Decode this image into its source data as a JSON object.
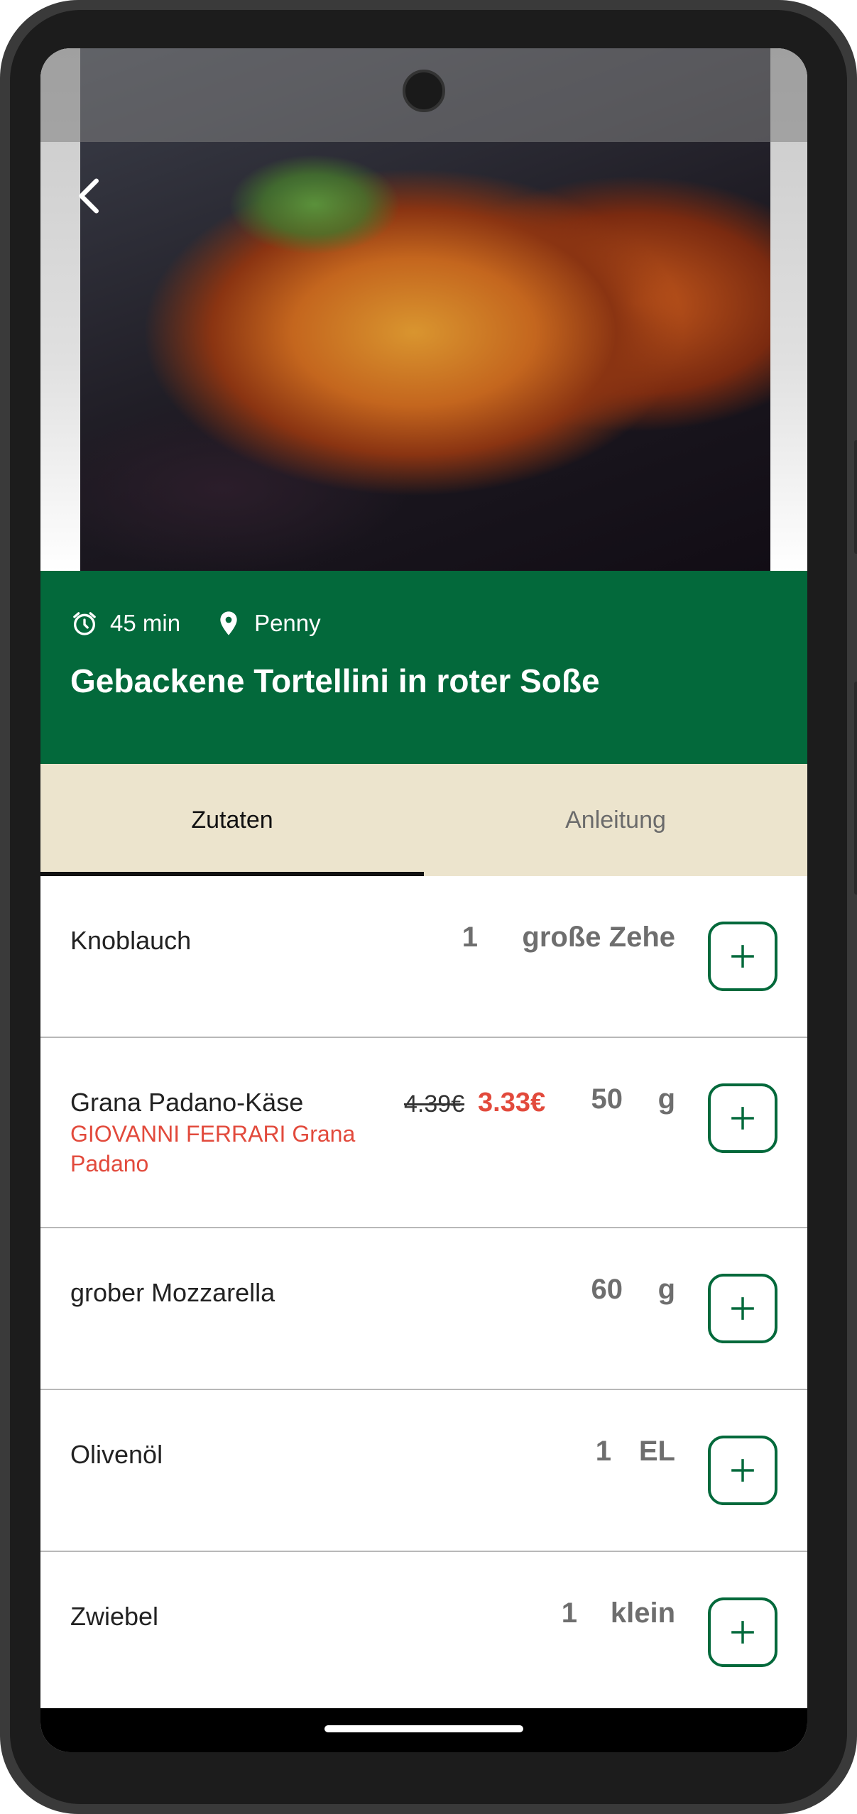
{
  "recipe": {
    "time": "45 min",
    "store": "Penny",
    "title": "Gebackene Tortellini in roter Soße"
  },
  "icons": {
    "back": "chevron-left-icon",
    "time": "alarm-clock-icon",
    "store": "location-pin-icon",
    "add": "plus-icon"
  },
  "tabs": [
    {
      "label": "Zutaten",
      "active": true
    },
    {
      "label": "Anleitung",
      "active": false
    }
  ],
  "ingredients": [
    {
      "name": "Knoblauch",
      "amount": "1",
      "unit": "große Zehe"
    },
    {
      "name": "Grana Padano-Käse",
      "product": "GIOVANNI FERRARI Grana Padano",
      "old_price": "4.39€",
      "new_price": "3.33€",
      "amount": "50",
      "unit": "g"
    },
    {
      "name": "grober Mozzarella",
      "amount": "60",
      "unit": "g"
    },
    {
      "name": "Olivenöl",
      "amount": "1",
      "unit": "EL"
    },
    {
      "name": "Zwiebel",
      "amount": "1",
      "unit": "klein"
    }
  ],
  "colors": {
    "brand_green": "#03693b",
    "tab_background": "#ece4cd",
    "sale_red": "#e24a3c"
  }
}
